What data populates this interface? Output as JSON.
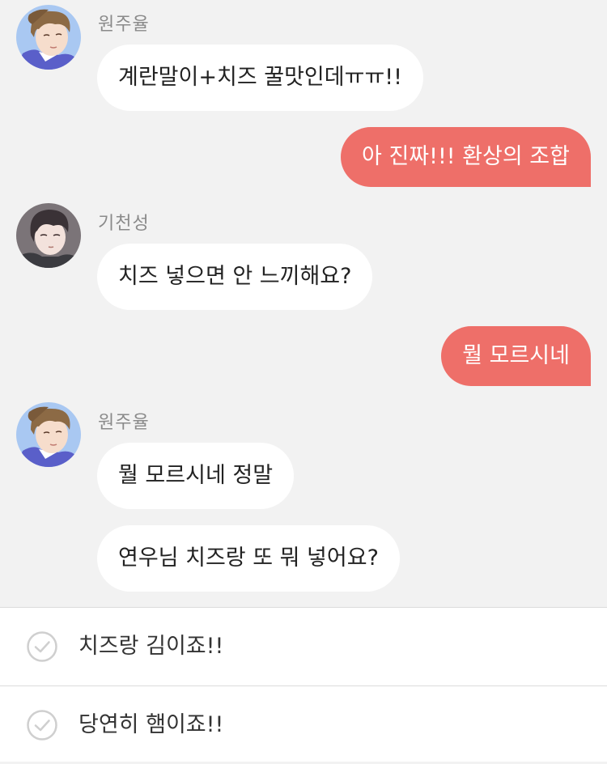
{
  "colors": {
    "background": "#f2f2f2",
    "incoming_bubble": "#ffffff",
    "outgoing_bubble": "#ee6f69",
    "sender_name": "#8a8a8a",
    "check_icon": "#cfcfcf"
  },
  "messages": [
    {
      "sender": "원주율",
      "avatar_icon": "avatar-wonjuyul",
      "text": "계란말이+치즈 꿀맛인데ㅠㅠ!!"
    },
    {
      "outgoing": true,
      "text": "아 진짜!!! 환상의 조합"
    },
    {
      "sender": "기천성",
      "avatar_icon": "avatar-gicheonseong",
      "text": "치즈 넣으면 안 느끼해요?"
    },
    {
      "outgoing": true,
      "text": "뭘 모르시네"
    },
    {
      "sender": "원주율",
      "avatar_icon": "avatar-wonjuyul",
      "text": "뭘 모르시네 정말"
    },
    {
      "continued": true,
      "text": "연우님 치즈랑 또 뭐 넣어요?"
    }
  ],
  "choices": [
    {
      "label": "치즈랑 김이죠!!",
      "icon": "check-circle-icon"
    },
    {
      "label": "당연히 햄이죠!!",
      "icon": "check-circle-icon"
    }
  ]
}
